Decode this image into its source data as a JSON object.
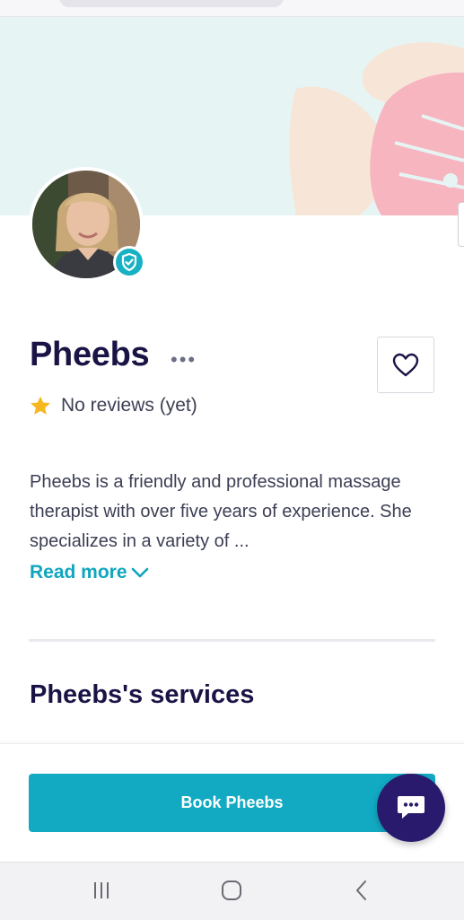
{
  "profile": {
    "name": "Pheebs",
    "more_label": "•••",
    "rating_text": "No reviews (yet)",
    "bio": "Pheebs is a friendly and professional massage therapist with over five years of experience. She specializes in a variety of ...",
    "read_more_label": "Read more",
    "services_heading": "Pheebs's services"
  },
  "cta": {
    "book_label": "Book Pheebs"
  },
  "colors": {
    "accent": "#12aac3",
    "heading": "#1a1446",
    "chat_bg": "#2a1a6e",
    "banner_bg": "#e6f4f4",
    "leaf_pink": "#f7b5bf",
    "leaf_cream": "#f7e6d8",
    "star": "#f5b820"
  },
  "icons": {
    "verified": "shield-check-icon",
    "favorite": "heart-outline-icon",
    "rating": "star-icon",
    "read_more": "chevron-down-icon",
    "chat": "chat-bubble-icon",
    "nav_recents": "recents-icon",
    "nav_home": "home-icon",
    "nav_back": "back-icon"
  }
}
